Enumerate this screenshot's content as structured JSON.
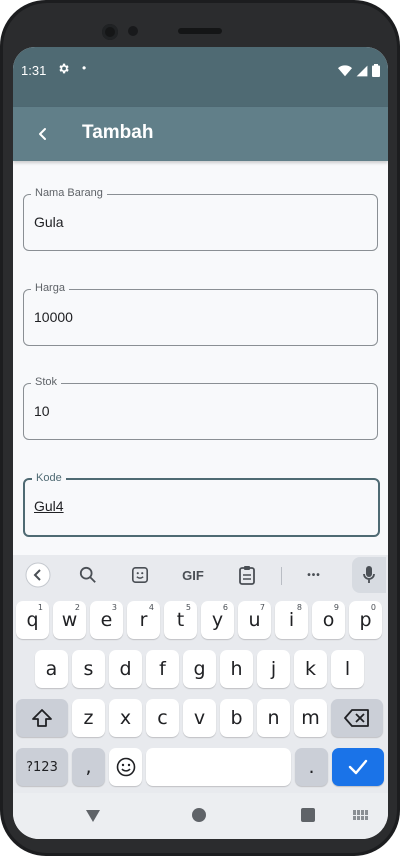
{
  "status": {
    "time": "1:31",
    "gear_icon": "settings-icon",
    "dot": "•"
  },
  "appbar": {
    "title": "Tambah",
    "back_icon": "back-arrow-icon"
  },
  "form": {
    "fields": [
      {
        "label": "Nama Barang",
        "value": "Gula"
      },
      {
        "label": "Harga",
        "value": "10000"
      },
      {
        "label": "Stok",
        "value": "10"
      },
      {
        "label": "Kode",
        "value": "Gul4"
      }
    ]
  },
  "keyboard": {
    "toolbar": {
      "gif": "GIF",
      "more": "•••"
    },
    "row1": [
      {
        "key": "q",
        "sup": "1"
      },
      {
        "key": "w",
        "sup": "2"
      },
      {
        "key": "e",
        "sup": "3"
      },
      {
        "key": "r",
        "sup": "4"
      },
      {
        "key": "t",
        "sup": "5"
      },
      {
        "key": "y",
        "sup": "6"
      },
      {
        "key": "u",
        "sup": "7"
      },
      {
        "key": "i",
        "sup": "8"
      },
      {
        "key": "o",
        "sup": "9"
      },
      {
        "key": "p",
        "sup": "0"
      }
    ],
    "row2": [
      "a",
      "s",
      "d",
      "f",
      "g",
      "h",
      "j",
      "k",
      "l"
    ],
    "row3": [
      "z",
      "x",
      "c",
      "v",
      "b",
      "n",
      "m"
    ],
    "symbols": "?123",
    "comma": ",",
    "period": "."
  },
  "colors": {
    "appbar": "#617f89",
    "statusbar": "#4f6a73",
    "enter": "#1a73e8"
  }
}
